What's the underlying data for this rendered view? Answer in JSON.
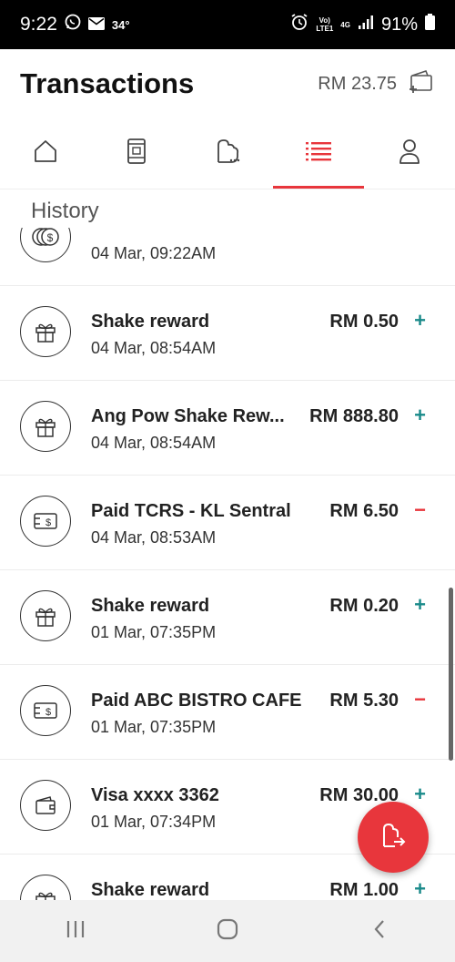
{
  "status_bar": {
    "time": "9:22",
    "temperature": "34°",
    "network_top": "Vo)",
    "network_bottom": "LTE1",
    "network_type": "4G",
    "battery": "91%"
  },
  "header": {
    "title": "Transactions",
    "balance": "RM 23.75"
  },
  "tabs": [
    {
      "icon": "home-icon",
      "active": false
    },
    {
      "icon": "phone-icon",
      "active": false
    },
    {
      "icon": "shake-icon",
      "active": false
    },
    {
      "icon": "list-icon",
      "active": true
    },
    {
      "icon": "profile-icon",
      "active": false
    }
  ],
  "history_label": "History",
  "transactions": [
    {
      "title": "",
      "date": "04 Mar, 09:22AM",
      "amount": "",
      "sign": "",
      "icon": "coins-icon"
    },
    {
      "title": "Shake reward",
      "date": "04 Mar, 08:54AM",
      "amount": "RM 0.50",
      "sign": "+",
      "icon": "gift-icon"
    },
    {
      "title": "Ang Pow Shake Rew...",
      "date": "04 Mar, 08:54AM",
      "amount": "RM 888.80",
      "sign": "+",
      "icon": "gift-icon"
    },
    {
      "title": "Paid TCRS - KL Sentral",
      "date": "04 Mar, 08:53AM",
      "amount": "RM 6.50",
      "sign": "−",
      "icon": "payment-icon"
    },
    {
      "title": "Shake reward",
      "date": "01 Mar, 07:35PM",
      "amount": "RM 0.20",
      "sign": "+",
      "icon": "gift-icon"
    },
    {
      "title": "Paid ABC BISTRO CAFE",
      "date": "01 Mar, 07:35PM",
      "amount": "RM 5.30",
      "sign": "−",
      "icon": "payment-icon"
    },
    {
      "title": "Visa xxxx 3362",
      "date": "01 Mar, 07:34PM",
      "amount": "RM 30.00",
      "sign": "+",
      "icon": "wallet-icon"
    },
    {
      "title": "Shake reward",
      "date": "",
      "amount": "RM 1.00",
      "sign": "+",
      "icon": "gift-icon"
    }
  ],
  "colors": {
    "accent": "#e8363c",
    "plus": "#1a8a8a",
    "minus": "#e8363c"
  }
}
